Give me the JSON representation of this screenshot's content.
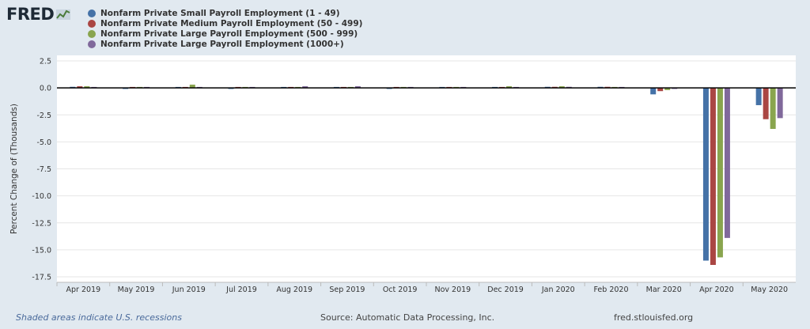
{
  "logo": {
    "text": "FRED"
  },
  "footer": {
    "recession_note": "Shaded areas indicate U.S. recessions",
    "source": "Source: Automatic Data Processing, Inc.",
    "url": "fred.stlouisfed.org"
  },
  "chart_data": {
    "type": "bar",
    "ylabel": "Percent Change of (Thousands)",
    "ylim": [
      -17.5,
      2.5
    ],
    "yticks": [
      2.5,
      0.0,
      -2.5,
      -5.0,
      -7.5,
      -10.0,
      -12.5,
      -15.0,
      -17.5
    ],
    "ytick_labels": [
      "2.5",
      "0.0",
      "-2.5",
      "-5.0",
      "-7.5",
      "-10.0",
      "-12.5",
      "-15.0",
      "-17.5"
    ],
    "grid": true,
    "legend_position": "top",
    "categories": [
      "Apr 2019",
      "May 2019",
      "Jun 2019",
      "Jul 2019",
      "Aug 2019",
      "Sep 2019",
      "Oct 2019",
      "Nov 2019",
      "Dec 2019",
      "Jan 2020",
      "Feb 2020",
      "Mar 2020",
      "Apr 2020",
      "May 2020"
    ],
    "series": [
      {
        "name": "Nonfarm Private Small Payroll Employment (1 - 49)",
        "color": "#4572a7",
        "values": [
          0.1,
          -0.1,
          0.0,
          -0.1,
          0.0,
          0.0,
          -0.1,
          0.0,
          0.0,
          0.1,
          0.1,
          -0.6,
          -16.0,
          -1.6
        ]
      },
      {
        "name": "Nonfarm Private Medium Payroll Employment (50 - 499)",
        "color": "#aa4643",
        "values": [
          0.15,
          0.0,
          0.0,
          0.0,
          0.0,
          0.0,
          0.0,
          0.0,
          0.05,
          0.1,
          0.1,
          -0.3,
          -16.4,
          -2.9
        ]
      },
      {
        "name": "Nonfarm Private Large Payroll Employment (500 - 999)",
        "color": "#89a54e",
        "values": [
          0.15,
          0.0,
          0.3,
          0.05,
          0.0,
          0.0,
          0.0,
          0.05,
          0.15,
          0.15,
          0.05,
          -0.2,
          -15.7,
          -3.8
        ]
      },
      {
        "name": "Nonfarm Private Large Payroll Employment (1000+)",
        "color": "#80699b",
        "values": [
          0.0,
          0.05,
          0.05,
          0.05,
          0.15,
          0.15,
          0.05,
          0.05,
          0.05,
          0.1,
          0.05,
          -0.1,
          -13.9,
          -2.8
        ]
      }
    ]
  }
}
